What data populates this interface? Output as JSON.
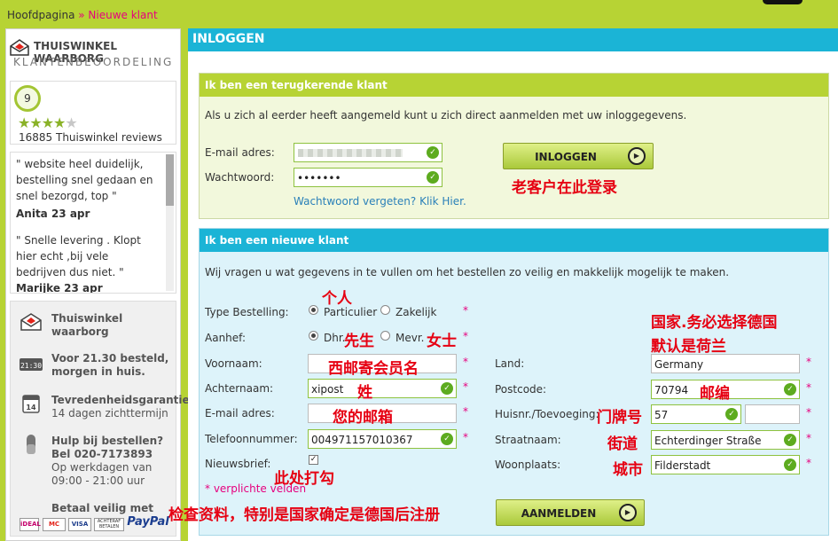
{
  "breadcrumb": {
    "home": "Hoofdpagina",
    "sep": " » ",
    "current": "Nieuwe klant"
  },
  "sidebar": {
    "tw_title": "THUISWINKEL WAARBORG",
    "tw_subtitle": "KLANTENBEOORDELING",
    "score": "9",
    "rating_stars": 4.5,
    "reviews_count": "16885 Thuiswinkel reviews",
    "reviews": [
      {
        "text": "\" website heel duidelijk, bestelling snel gedaan en snel bezorgd, top \"",
        "author": "Anita 23 apr"
      },
      {
        "text": "\" Snelle levering . Klopt hier echt ,bij vele bedrijven dus niet. \"",
        "author": "Marijke 23 apr"
      }
    ],
    "features": [
      {
        "icon": "thuiswinkel-icon",
        "title": "Thuiswinkel",
        "line2": "waarborg"
      },
      {
        "icon": "clock-2130-icon",
        "title": "Voor 21.30 besteld,",
        "line2": "morgen in huis."
      },
      {
        "icon": "calendar-14-icon",
        "title": "Tevredenheidsgarantie",
        "line2": "14 dagen zichttermijn"
      },
      {
        "icon": "phone-icon",
        "title": "Hulp bij bestellen?",
        "line2": "Bel 020-7173893",
        "line3": "Op werkdagen van",
        "line4": "09:00 - 21:00 uur"
      }
    ],
    "pay_title": "Betaal veilig met",
    "pay_methods": [
      "iDEAL",
      "MC",
      "VISA",
      "ACHTERAF BETALEN",
      "PayPal"
    ],
    "clock_text": "21:30",
    "calendar_text": "14"
  },
  "main": {
    "title": "INLOGGEN",
    "returning": {
      "title": "Ik ben een terugkerende klant",
      "intro": "Als u zich al eerder heeft aangemeld kunt u zich direct aanmelden met uw inloggegevens.",
      "email_label": "E-mail adres:",
      "email_value": "",
      "password_label": "Wachtwoord:",
      "password_value": "•••••••",
      "forgot": "Wachtwoord vergeten? Klik Hier.",
      "login_button": "INLOGGEN"
    },
    "new": {
      "title": "Ik ben een nieuwe klant",
      "intro": "Wij vragen u wat gegevens in te vullen om het bestellen zo veilig en makkelijk mogelijk te maken.",
      "type_label": "Type Bestelling:",
      "type_options": [
        "Particulier",
        "Zakelijk"
      ],
      "salutation_label": "Aanhef:",
      "salutation_options": [
        "Dhr.",
        "Mevr."
      ],
      "firstname_label": "Voornaam:",
      "firstname_value": "",
      "lastname_label": "Achternaam:",
      "lastname_value": "xipost",
      "email_label": "E-mail adres:",
      "email_value": "",
      "phone_label": "Telefoonnummer:",
      "phone_value": "004971157010367",
      "newsletter_label": "Nieuwsbrief:",
      "newsletter_checked": true,
      "country_label": "Land:",
      "country_value": "Germany",
      "postcode_label": "Postcode:",
      "postcode_value": "70794",
      "house_label": "Huisnr./Toevoeging:",
      "house_value": "57",
      "house_add_value": "",
      "street_label": "Straatnaam:",
      "street_value": "Echterdinger Straße",
      "city_label": "Woonplaats:",
      "city_value": "Filderstadt",
      "required_note": "* verplichte velden",
      "register_button": "AANMELDEN",
      "required_mark": "*"
    }
  },
  "annotations": {
    "login_hint": "老客户在此登录",
    "personal": "个人",
    "mister": "先生",
    "miss": "女士",
    "firstname": "西邮寄会员名",
    "surname": "姓",
    "email": "您的邮箱",
    "newsletter": "此处打勾",
    "country_line1": "国家.务必选择德国",
    "country_line2": "默认是荷兰",
    "postcode": "邮编",
    "house": "门牌号",
    "street": "街道",
    "city": "城市",
    "bottom": "检查资料，特别是国家确定是德国后注册"
  },
  "colors": {
    "lime": "#b7d334",
    "cyan": "#1bb4d6",
    "magenta": "#e6007e",
    "annotation_red": "#e60012"
  }
}
